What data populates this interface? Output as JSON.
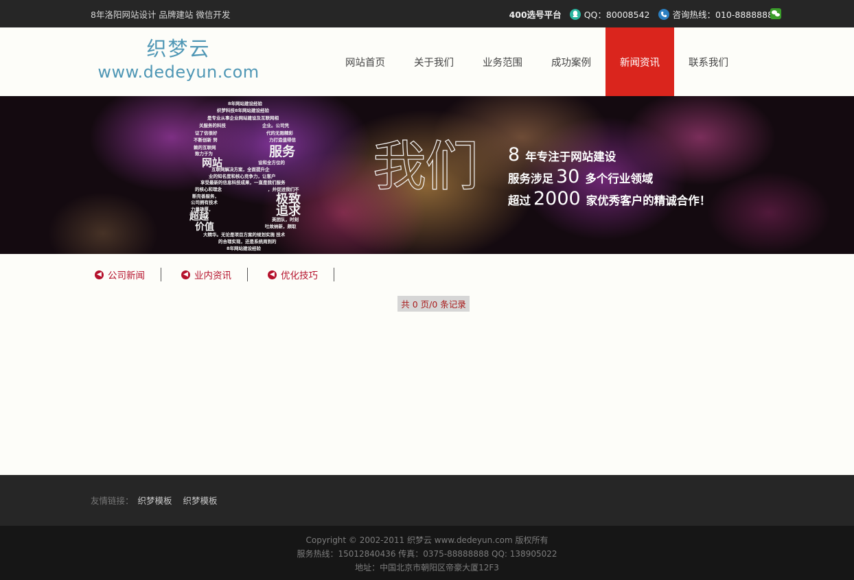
{
  "topbar": {
    "slogan": "8年洛阳网站设计 品牌建站 微信开发",
    "platform": "400选号平台",
    "qq": "QQ：80008542",
    "hotline": "咨询热线：010-88888888",
    "icons": [
      "qq-icon",
      "phone-icon",
      "wechat-icon"
    ]
  },
  "logo": {
    "cn": "织梦云",
    "en": "www.dedeyun.com"
  },
  "nav": {
    "items": [
      {
        "label": "网站首页"
      },
      {
        "label": "关于我们"
      },
      {
        "label": "业务范围"
      },
      {
        "label": "成功案例"
      },
      {
        "label": "新闻资讯",
        "active": true
      },
      {
        "label": "联系我们"
      }
    ]
  },
  "banner": {
    "women": "我们",
    "line1_num": "8",
    "line1_text": "年专注于网站建设",
    "line2_pre": "服务涉足",
    "line2_num": "30",
    "line2_text": "多个行业领域",
    "line3_pre": "超过",
    "line3_num": "2000",
    "line3_text": "家优秀客户的精诚合作！",
    "wordcloud": {
      "w1": "8年网站建设经验",
      "w2": "织梦科技8年网站建设经验",
      "w3": "是专业从事企业网站建设及互联网相",
      "w4": "关服务的科技",
      "w5": "企业。公司凭",
      "w6": "证了信很好",
      "w7": "代的无限精彩",
      "w8": "不断创新 努",
      "w9": "力打造值得信",
      "w10": "赖的互联网",
      "w11": "服务",
      "w12": "致力于为",
      "w13": "网站",
      "w14": "设和全方位的",
      "w15": "互联网解决方案，全面提升企",
      "w16": "业的知名度和核心竞争力，让客户",
      "w17": "享受最新的信息科技成果，一直是我们服务",
      "w18": "的核心和理念",
      "w19": "，并促进我们不",
      "w20": "断完善服务，",
      "w21": "极致",
      "w22": "公司拥有技术",
      "w23": "追求",
      "w24": "力量雄厚，",
      "w25": "超越",
      "w26": "英团队，时刻",
      "w27": "价值",
      "w28": "吐故纳新，颇取",
      "w29": "大精华。无论是项目方案的规划实施 技术",
      "w30": "的合理实现，还是系统周到的",
      "w31": "8年网站建设经验"
    }
  },
  "subnav": {
    "items": [
      {
        "label": "公司新闻"
      },
      {
        "label": "业内资讯"
      },
      {
        "label": "优化技巧"
      }
    ]
  },
  "pager": {
    "text": "共 0 页/0 条记录"
  },
  "footer": {
    "links_label": "友情链接：",
    "links": [
      {
        "label": "织梦模板"
      },
      {
        "label": "织梦模板"
      }
    ],
    "copyright": "Copyright © 2002-2011 织梦云 www.dedeyun.com 版权所有",
    "contact": "服务热线：15012840436   传真：0375-88888888   QQ: 138905022",
    "address": "地址：中国北京市朝阳区帝豪大厦12F3"
  },
  "colors": {
    "topbar_bg": "#262626",
    "accent_red": "#da251d",
    "logo_blue": "#4f97b5",
    "subnav_red": "#b5122c"
  }
}
